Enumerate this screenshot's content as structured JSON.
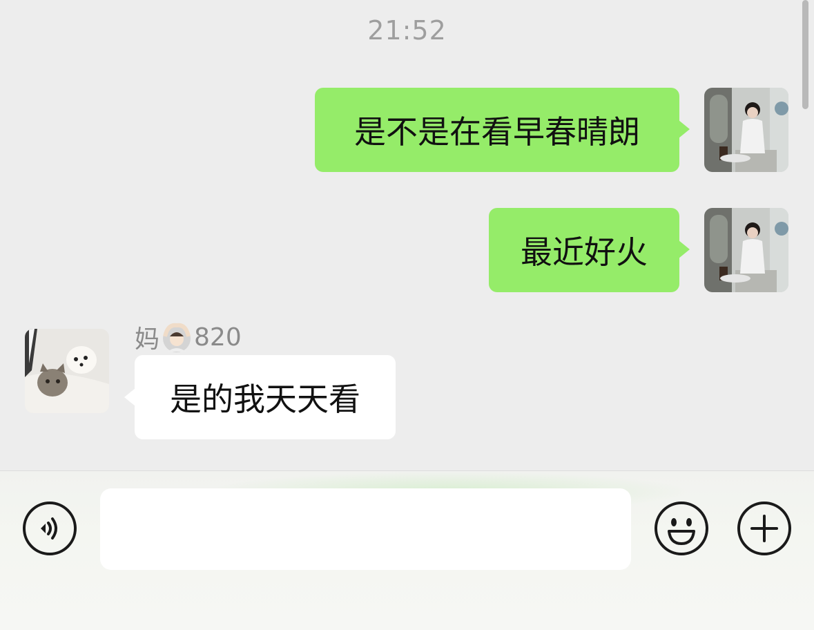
{
  "chat": {
    "timestamp": "21:52",
    "messages": [
      {
        "side": "sent",
        "text": "是不是在看早春晴朗"
      },
      {
        "side": "sent",
        "text": "最近好火"
      },
      {
        "side": "received",
        "sender": "妈",
        "sender_suffix": "820",
        "sender_emoji": "person-gesturing-ok-emoji",
        "text": "是的我天天看"
      }
    ]
  },
  "input_bar": {
    "input_value": "",
    "voice_icon": "voice-icon",
    "emoji_icon": "smiley-icon",
    "more_icon": "plus-icon"
  },
  "colors": {
    "sent_bubble": "#95ec69",
    "received_bubble": "#ffffff",
    "background": "#ededed"
  }
}
